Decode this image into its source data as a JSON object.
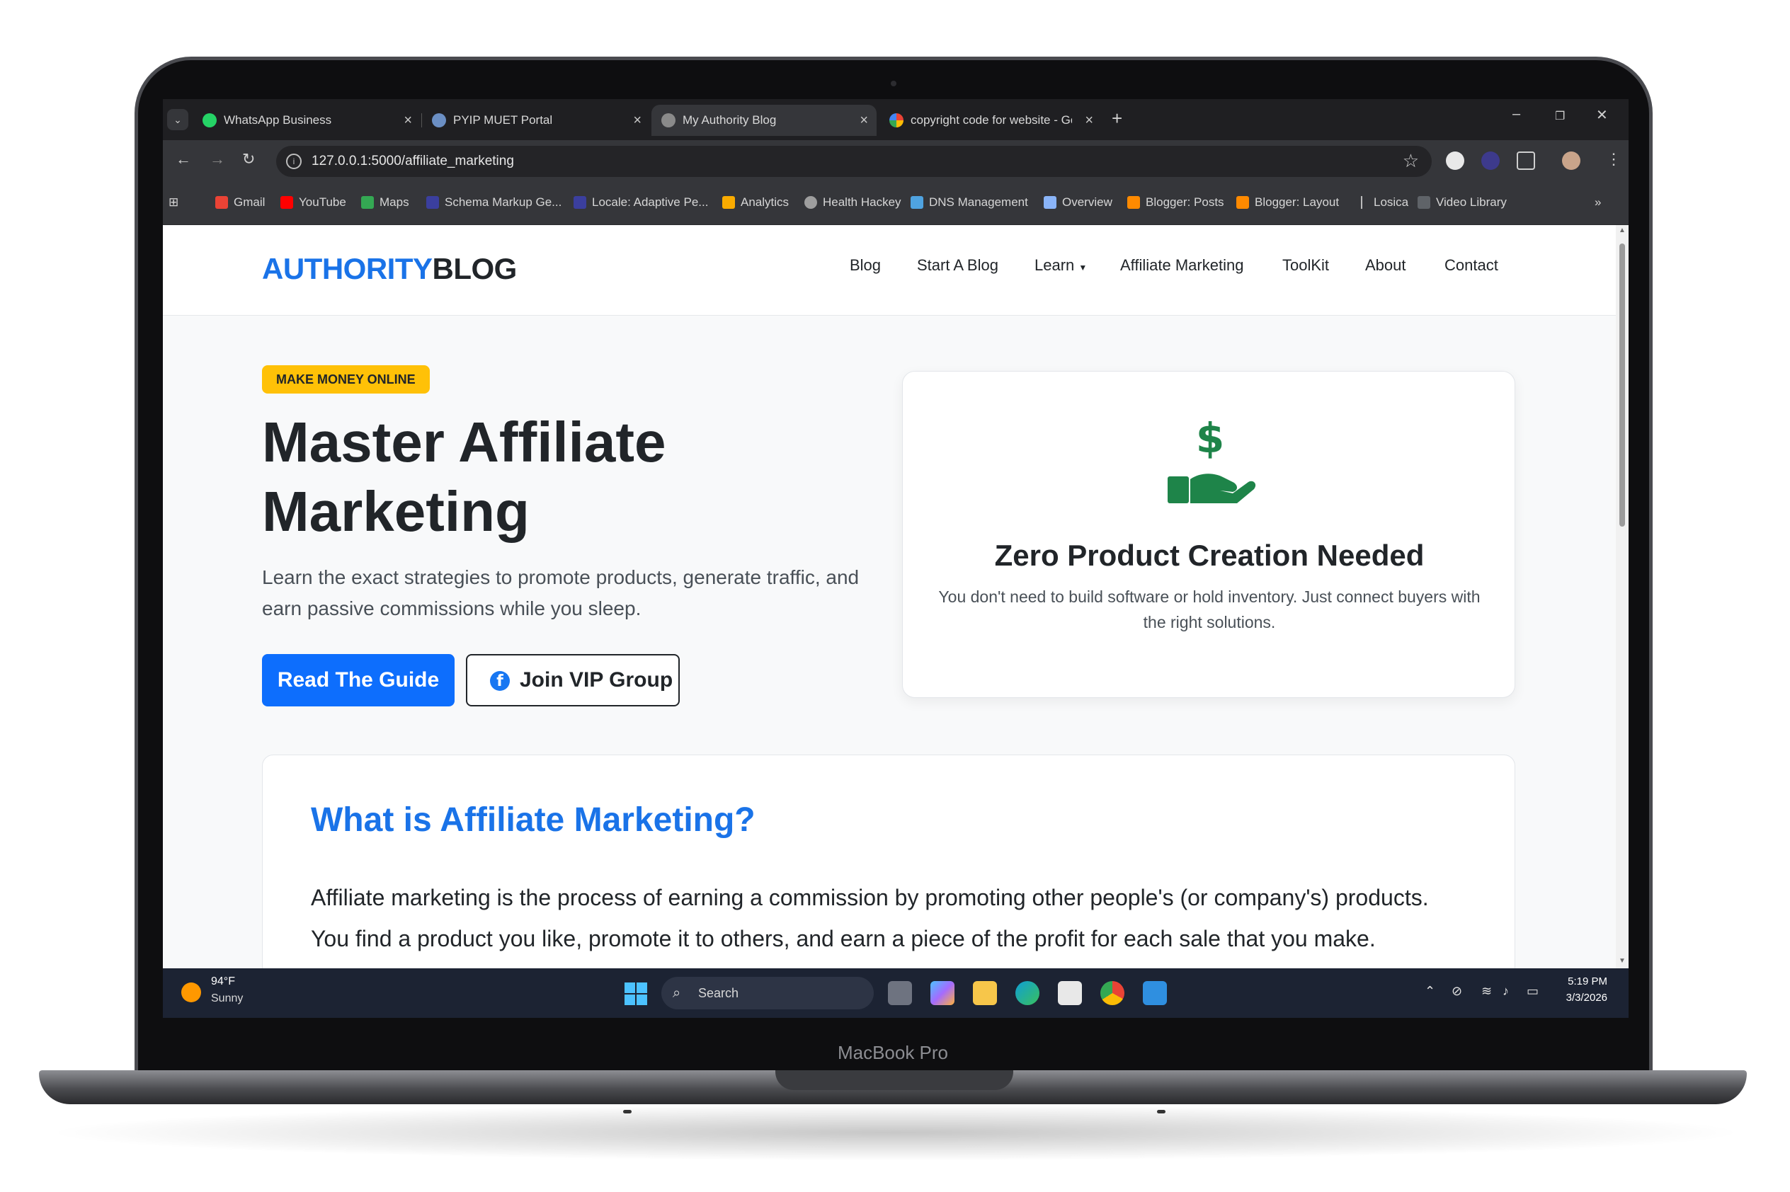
{
  "device": {
    "brand": "MacBook Pro"
  },
  "browser": {
    "tabs": [
      {
        "label": "WhatsApp Business",
        "icon": "whatsapp-icon",
        "active": false
      },
      {
        "label": "PYIP MUET Portal",
        "icon": "globe-icon",
        "active": false
      },
      {
        "label": "My Authority Blog",
        "icon": "globe-icon",
        "active": true
      },
      {
        "label": "copyright code for website - Go",
        "icon": "google-icon",
        "active": false
      }
    ],
    "url": "127.0.0.1:5000/affiliate_marketing",
    "bookmarks": [
      {
        "label": "Gmail",
        "color": "#ea4335"
      },
      {
        "label": "YouTube",
        "color": "#ff0000"
      },
      {
        "label": "Maps",
        "color": "#34a853"
      },
      {
        "label": "Schema Markup Ge...",
        "color": "#3b3f9e"
      },
      {
        "label": "Locale: Adaptive Pe...",
        "color": "#3b3f9e"
      },
      {
        "label": "Analytics",
        "color": "#f9ab00"
      },
      {
        "label": "Health Hackey",
        "color": "#9e9e9e"
      },
      {
        "label": "DNS Management",
        "color": "#4fa3e0"
      },
      {
        "label": "Overview",
        "color": "#8ab4f8"
      },
      {
        "label": "Blogger: Posts",
        "color": "#ff8a00"
      },
      {
        "label": "Blogger: Layout",
        "color": "#ff8a00"
      },
      {
        "label": "Losica",
        "color": "#35363a"
      },
      {
        "label": "Video Library",
        "color": "#5f6368"
      }
    ]
  },
  "site": {
    "logo_part1": "AUTHORITY",
    "logo_part2": "BLOG",
    "nav": [
      "Blog",
      "Start A Blog",
      "Learn",
      "Affiliate Marketing",
      "ToolKit",
      "About",
      "Contact"
    ],
    "hero": {
      "badge": "MAKE MONEY ONLINE",
      "title": "Master Affiliate Marketing",
      "text": "Learn the exact strategies to promote products, generate traffic, and earn passive commissions while you sleep.",
      "primary_button": "Read The Guide",
      "secondary_button": "Join VIP Group"
    },
    "feature_card": {
      "icon": "money-hand-icon",
      "title": "Zero Product Creation Needed",
      "text": "You don't need to build software or hold inventory. Just connect buyers with the right solutions."
    },
    "section": {
      "title": "What is Affiliate Marketing?",
      "text": "Affiliate marketing is the process of earning a commission by promoting other people's (or company's) products. You find a product you like, promote it to others, and earn a piece of the profit for each sale that you make."
    }
  },
  "taskbar": {
    "temperature": "94°F",
    "weather": "Sunny",
    "search_placeholder": "Search",
    "time": "5:19 PM",
    "date": "3/3/2026"
  },
  "colors": {
    "accent": "#1a73e8",
    "primary_button": "#0d6efd",
    "badge": "#ffc107",
    "money_icon": "#1e8449"
  }
}
